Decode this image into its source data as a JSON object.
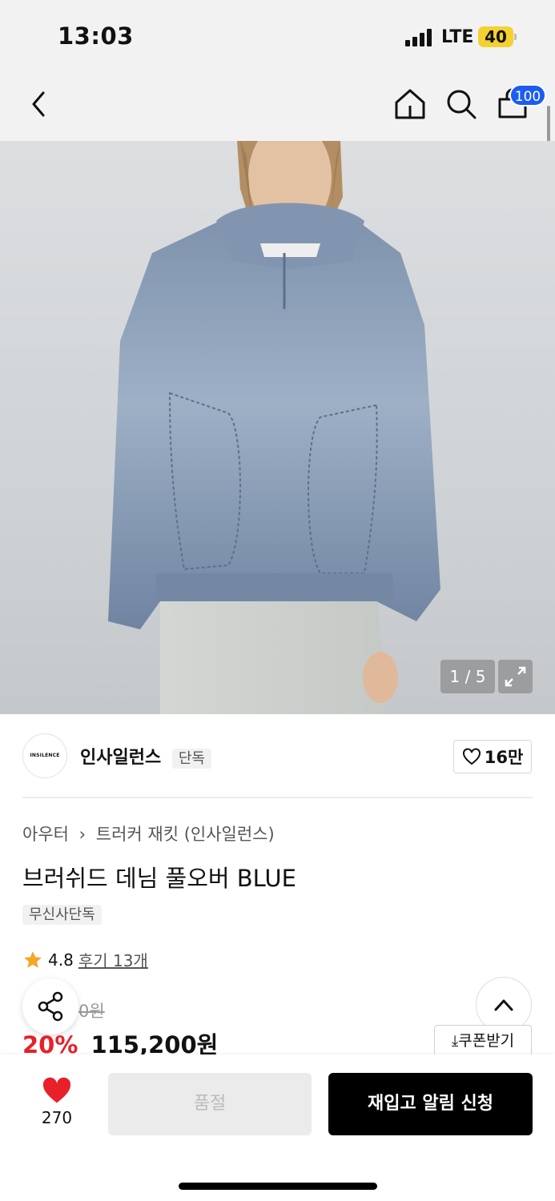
{
  "status_bar": {
    "time": "13:03",
    "network": "LTE",
    "battery": "40"
  },
  "nav": {
    "cart_count": "100"
  },
  "gallery": {
    "counter": "1 / 5"
  },
  "brand": {
    "logo_text": "INSILENCE",
    "name": "인사일런스",
    "exclusive_tag": "단독",
    "likes": "16만"
  },
  "product": {
    "breadcrumb": [
      "아우터",
      "트러커 재킷 (인사일런스)"
    ],
    "title": "브러쉬드 데님 풀오버 BLUE",
    "badge": "무신사단독",
    "rating": "4.8",
    "review_link": "후기 13개",
    "original_price": "0원",
    "discount": "20%",
    "price": "115,200원",
    "coupon_label": "쿠폰받기"
  },
  "bottom_bar": {
    "like_count": "270",
    "soldout_label": "품절",
    "restock_label": "재입고 알림 신청"
  },
  "colors": {
    "discount": "#e8202a",
    "badge_blue": "#1b5cf2",
    "star": "#f5a623",
    "heart": "#e8202a"
  }
}
